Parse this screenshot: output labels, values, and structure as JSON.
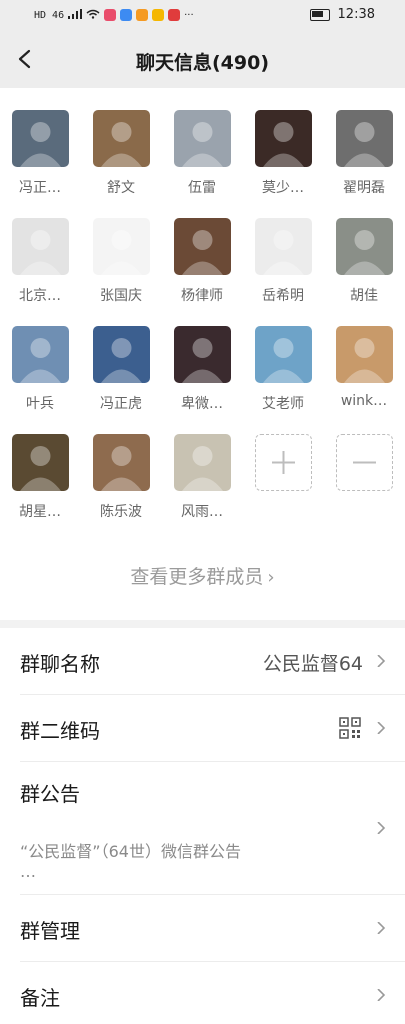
{
  "status_bar": {
    "left_text": "HD 46",
    "time": "12:38"
  },
  "header": {
    "title": "聊天信息(490)"
  },
  "members": [
    {
      "name": "冯正…",
      "bg": "#5a6b7c"
    },
    {
      "name": "舒文",
      "bg": "#8a6a4a"
    },
    {
      "name": "伍雷",
      "bg": "#9aa3ad"
    },
    {
      "name": "莫少…",
      "bg": "#3b2a26"
    },
    {
      "name": "翟明磊",
      "bg": "#6e6e6e"
    },
    {
      "name": "北京…",
      "bg": "#e3e3e3"
    },
    {
      "name": "张国庆",
      "bg": "#f4f4f4"
    },
    {
      "name": "杨律师",
      "bg": "#6b4a36"
    },
    {
      "name": "岳希明",
      "bg": "#ececec"
    },
    {
      "name": "胡佳",
      "bg": "#8a8f88"
    },
    {
      "name": "叶兵",
      "bg": "#6f8fb3"
    },
    {
      "name": "冯正虎",
      "bg": "#3c5f8f"
    },
    {
      "name": "卑微…",
      "bg": "#3a2a2e"
    },
    {
      "name": "艾老师",
      "bg": "#6ea3c8"
    },
    {
      "name": "wink…",
      "bg": "#c89a6a"
    },
    {
      "name": "胡星…",
      "bg": "#5a4a32"
    },
    {
      "name": "陈乐波",
      "bg": "#8e6b4e"
    },
    {
      "name": "风雨…",
      "bg": "#c8c2b2"
    }
  ],
  "see_more": "查看更多群成员",
  "settings": {
    "group_name_label": "群聊名称",
    "group_name_value": "公民监督64",
    "qr_label": "群二维码",
    "notice_label": "群公告",
    "notice_text": "“公民监督”（64世）微信群公告",
    "notice_ellipsis": "…",
    "manage_label": "群管理",
    "remark_label": "备注"
  }
}
